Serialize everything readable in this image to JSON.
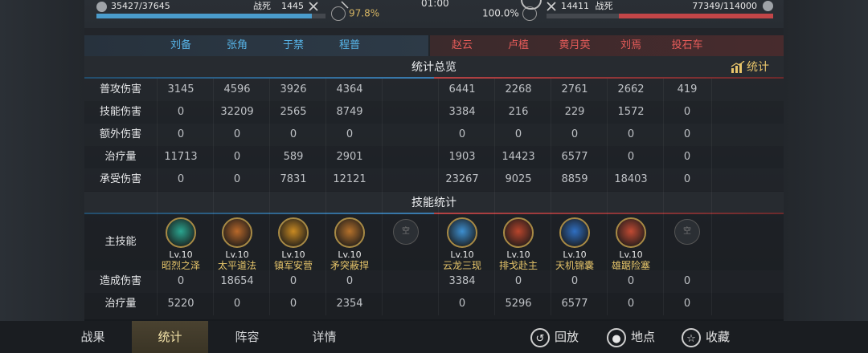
{
  "top": {
    "left_hp": "35427/37645",
    "left_dead_label": "战死",
    "left_dead_count": "1445",
    "left_rate": "97.8%",
    "timer": "01:00",
    "right_rate": "100.0%",
    "right_dead_count": "14411",
    "right_dead_label": "战死",
    "right_hp": "77349/114000",
    "left_hp_fraction": 0.94,
    "right_hp_fraction": 0.68
  },
  "heroes": {
    "blue": [
      "刘备",
      "张角",
      "于禁",
      "程普"
    ],
    "red": [
      "赵云",
      "卢植",
      "黄月英",
      "刘焉",
      "投石车"
    ]
  },
  "overview": {
    "title": "统计总览",
    "stat_button": "统计",
    "rows": [
      {
        "label": "普攻伤害",
        "blue": [
          "3145",
          "4596",
          "3926",
          "4364"
        ],
        "red": [
          "6441",
          "2268",
          "2761",
          "2662",
          "419"
        ]
      },
      {
        "label": "技能伤害",
        "blue": [
          "0",
          "32209",
          "2565",
          "8749"
        ],
        "red": [
          "3384",
          "216",
          "229",
          "1572",
          "0"
        ]
      },
      {
        "label": "额外伤害",
        "blue": [
          "0",
          "0",
          "0",
          "0"
        ],
        "red": [
          "0",
          "0",
          "0",
          "0",
          "0"
        ]
      },
      {
        "label": "治疗量",
        "blue": [
          "11713",
          "0",
          "589",
          "2901"
        ],
        "red": [
          "1903",
          "14423",
          "6577",
          "0",
          "0"
        ]
      },
      {
        "label": "承受伤害",
        "blue": [
          "0",
          "0",
          "7831",
          "12121"
        ],
        "red": [
          "23267",
          "9025",
          "8859",
          "18403",
          "0"
        ]
      }
    ]
  },
  "skills": {
    "title": "技能统计",
    "main_label": "主技能",
    "empty_label": "空",
    "blue": [
      {
        "lv": "Lv.10",
        "name": "昭烈之泽",
        "color": "#2aa58f"
      },
      {
        "lv": "Lv.10",
        "name": "太平道法",
        "color": "#b8682a"
      },
      {
        "lv": "Lv.10",
        "name": "镇军安营",
        "color": "#c98a22"
      },
      {
        "lv": "Lv.10",
        "name": "矛突蔽捍",
        "color": "#b5712b"
      }
    ],
    "red": [
      {
        "lv": "Lv.10",
        "name": "云龙三现",
        "color": "#3d8fd0"
      },
      {
        "lv": "Lv.10",
        "name": "排戈赴主",
        "color": "#b8452c"
      },
      {
        "lv": "Lv.10",
        "name": "天机锦囊",
        "color": "#2f6fc2"
      },
      {
        "lv": "Lv.10",
        "name": "雄踞险塞",
        "color": "#c14a33"
      }
    ],
    "rows": [
      {
        "label": "造成伤害",
        "blue": [
          "0",
          "18654",
          "0",
          "0"
        ],
        "red": [
          "3384",
          "0",
          "0",
          "0",
          "0"
        ]
      },
      {
        "label": "治疗量",
        "blue": [
          "5220",
          "0",
          "0",
          "2354"
        ],
        "red": [
          "0",
          "5296",
          "6577",
          "0",
          "0"
        ]
      }
    ]
  },
  "bottom": {
    "tabs": [
      "战果",
      "统计",
      "阵容",
      "详情"
    ],
    "actions": [
      "回放",
      "地点",
      "收藏"
    ]
  }
}
